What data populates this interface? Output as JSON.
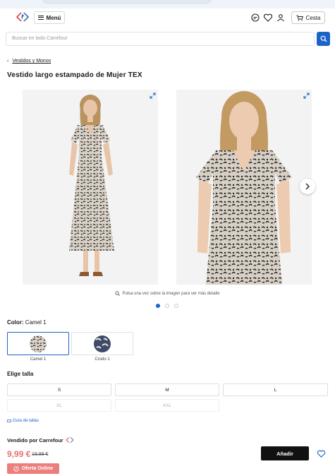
{
  "header": {
    "menu_label": "Menú",
    "cart_label": "Cesta",
    "icons": [
      "carrefour-logo",
      "support-icon",
      "heart-icon",
      "user-icon",
      "cart-icon"
    ]
  },
  "search": {
    "placeholder": "Buscar en todo Carrefour"
  },
  "breadcrumb": {
    "back_label": "Vestidos y Monos"
  },
  "product": {
    "title": "Vestido largo estampado de Mujer TEX",
    "gallery_hint": "Pulsa una vez sobre la imagen para ver más detalle",
    "gallery_dots": 3,
    "gallery_active_index": 0
  },
  "color": {
    "label": "Color:",
    "selected": "Camel 1",
    "options": [
      "Camel 1",
      "Crudo 1"
    ]
  },
  "sizes": {
    "label": "Elige talla",
    "options": [
      {
        "label": "S",
        "available": true
      },
      {
        "label": "M",
        "available": true
      },
      {
        "label": "L",
        "available": true
      },
      {
        "label": "XL",
        "available": false
      },
      {
        "label": "XXL",
        "available": false
      }
    ],
    "guide_label": "Guía de tallas"
  },
  "purchase": {
    "seller_label": "Vendido por Carrefour",
    "price": "9,99 €",
    "old_price": "19,99 €",
    "add_label": "Añadir",
    "badge_label": "Oferta Online"
  },
  "colors": {
    "accent": "#1c63c9",
    "price": "#e5736f",
    "badge": "#eb7f7e",
    "button": "#111111"
  }
}
